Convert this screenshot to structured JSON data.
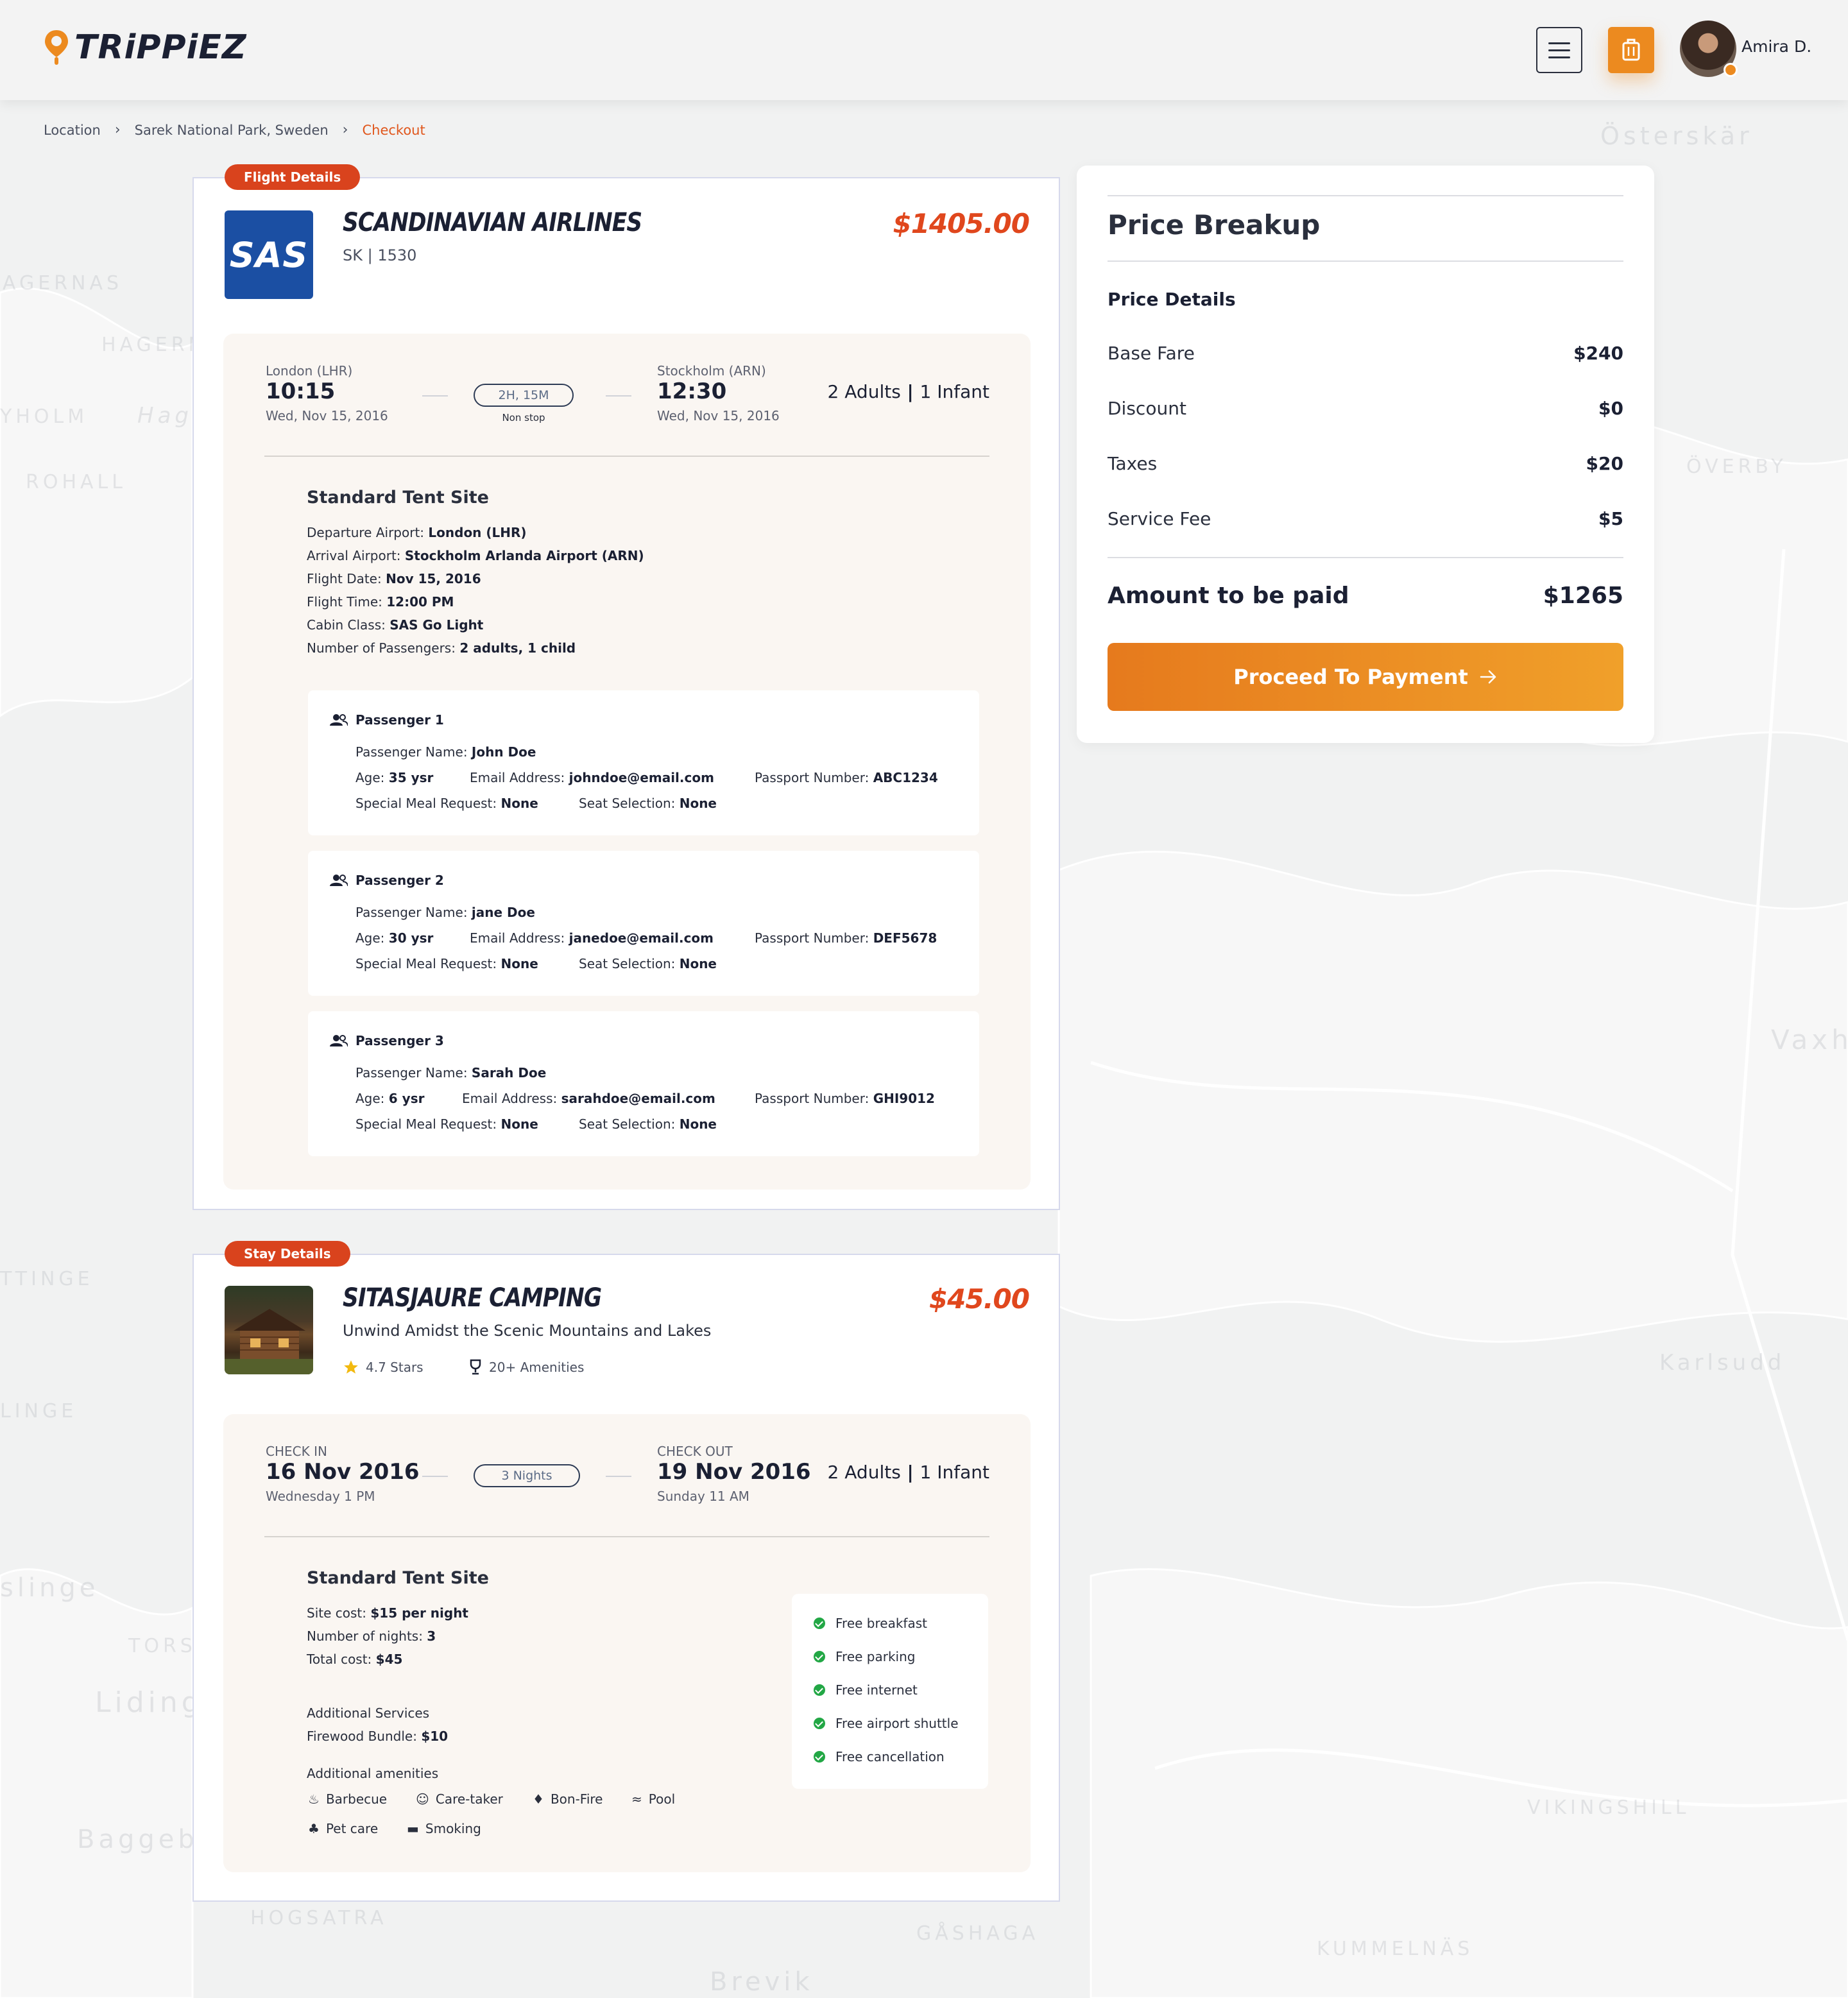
{
  "header": {
    "logo": "TRiPPiEZ",
    "user_name": "Amira D."
  },
  "breadcrumb": [
    "Location",
    "Sarek National Park, Sweden",
    "Checkout"
  ],
  "map_labels": [
    "Österskär",
    "AGERNAS",
    "HAGERN",
    "YHOLM",
    "Hag",
    "ROHALL",
    "ÖVERBY",
    "Vaxho",
    "TTINGE",
    "LINGE",
    "Karlsudd",
    "slinge",
    "TORS",
    "Lidingö",
    "VIKINGSHILL",
    "Baggeby",
    "HOGSATRA",
    "GÅSHAGA",
    "KUMMELNÄS",
    "Brevik"
  ],
  "flight": {
    "tag": "Flight Details",
    "logo_text": "SAS",
    "airline": "SCANDINAVIAN AIRLINES",
    "code": "SK | 1530",
    "price": "$1405.00",
    "from_city": "London (LHR)",
    "from_time": "10:15",
    "from_date": "Wed, Nov 15, 2016",
    "duration": "2H, 15M",
    "stops": "Non stop",
    "to_city": "Stockholm (ARN)",
    "to_time": "12:30",
    "to_date": "Wed, Nov 15, 2016",
    "adults": "2 Adults",
    "sep": " | ",
    "infants": "1 Infant",
    "site_title": "Standard Tent Site",
    "details": [
      {
        "label": "Departure Airport: ",
        "value": "London (LHR)"
      },
      {
        "label": "Arrival Airport: ",
        "value": "Stockholm Arlanda Airport (ARN)"
      },
      {
        "label": "Flight Date: ",
        "value": "Nov 15, 2016"
      },
      {
        "label": "Flight Time: ",
        "value": "12:00 PM"
      },
      {
        "label": "Cabin Class: ",
        "value": "SAS Go Light"
      },
      {
        "label": "Number of Passengers: ",
        "value": "2 adults, 1 child"
      }
    ],
    "labels": {
      "name": "Passenger Name: ",
      "age": "Age: ",
      "email": "Email Address: ",
      "passport": "Passport Number: ",
      "meal": "Special Meal Request: ",
      "seat": "Seat Selection: "
    },
    "passengers": [
      {
        "title": "Passenger 1",
        "name": "John Doe",
        "age": "35 ysr",
        "email": "johndoe@email.com",
        "passport": "ABC1234",
        "meal": "None",
        "seat": "None"
      },
      {
        "title": "Passenger 2",
        "name": "jane Doe",
        "age": "30 ysr",
        "email": "janedoe@email.com",
        "passport": "DEF5678",
        "meal": "None",
        "seat": "None"
      },
      {
        "title": "Passenger 3",
        "name": "Sarah Doe",
        "age": "6 ysr",
        "email": "sarahdoe@email.com",
        "passport": "GHI9012",
        "meal": "None",
        "seat": "None"
      }
    ]
  },
  "stay": {
    "tag": "Stay Details",
    "name": "SITASJAURE CAMPING",
    "tagline": "Unwind Amidst the Scenic Mountains and Lakes",
    "price": "$45.00",
    "stars": "4.7 Stars",
    "amenities_count": "20+ Amenities",
    "checkin_label": "CHECK IN",
    "checkin_date": "16 Nov 2016",
    "checkin_day": "Wednesday  1 PM",
    "nights": "3 Nights",
    "checkout_label": "CHECK OUT",
    "checkout_date": "19 Nov 2016",
    "checkout_day": "Sunday  11 AM",
    "adults": "2 Adults",
    "sep": " | ",
    "infants": "1 Infant",
    "site_title": "Standard Tent Site",
    "costs": [
      {
        "label": "Site cost: ",
        "value": "$15 per night"
      },
      {
        "label": "Number of nights: ",
        "value": "3"
      },
      {
        "label": "Total cost: ",
        "value": "$45"
      }
    ],
    "additional_services_title": "Additional Services",
    "services": [
      {
        "label": "Firewood Bundle: ",
        "value": "$10"
      }
    ],
    "additional_amenities_title": "Additional amenities",
    "extra_amenities": [
      "Barbecue",
      "Care-taker",
      "Bon-Fire",
      "Pool",
      "Pet care",
      "Smoking"
    ],
    "free_amenities": [
      "Free breakfast",
      "Free parking",
      "Free internet",
      "Free airport shuttle",
      "Free cancellation"
    ]
  },
  "price_breakup": {
    "title": "Price Breakup",
    "subtitle": "Price Details",
    "rows": [
      {
        "label": "Base Fare",
        "value": "$240"
      },
      {
        "label": "Discount",
        "value": "$0"
      },
      {
        "label": "Taxes",
        "value": "$20"
      },
      {
        "label": "Service Fee",
        "value": "$5"
      }
    ],
    "total_label": "Amount to be paid",
    "total_value": "$1265",
    "button_label": "Proceed To Payment"
  },
  "colors": {
    "accent_orange": "#ec8a1f",
    "price_red": "#e0471d",
    "tag_red": "#d9431d",
    "check_green": "#22a745"
  }
}
